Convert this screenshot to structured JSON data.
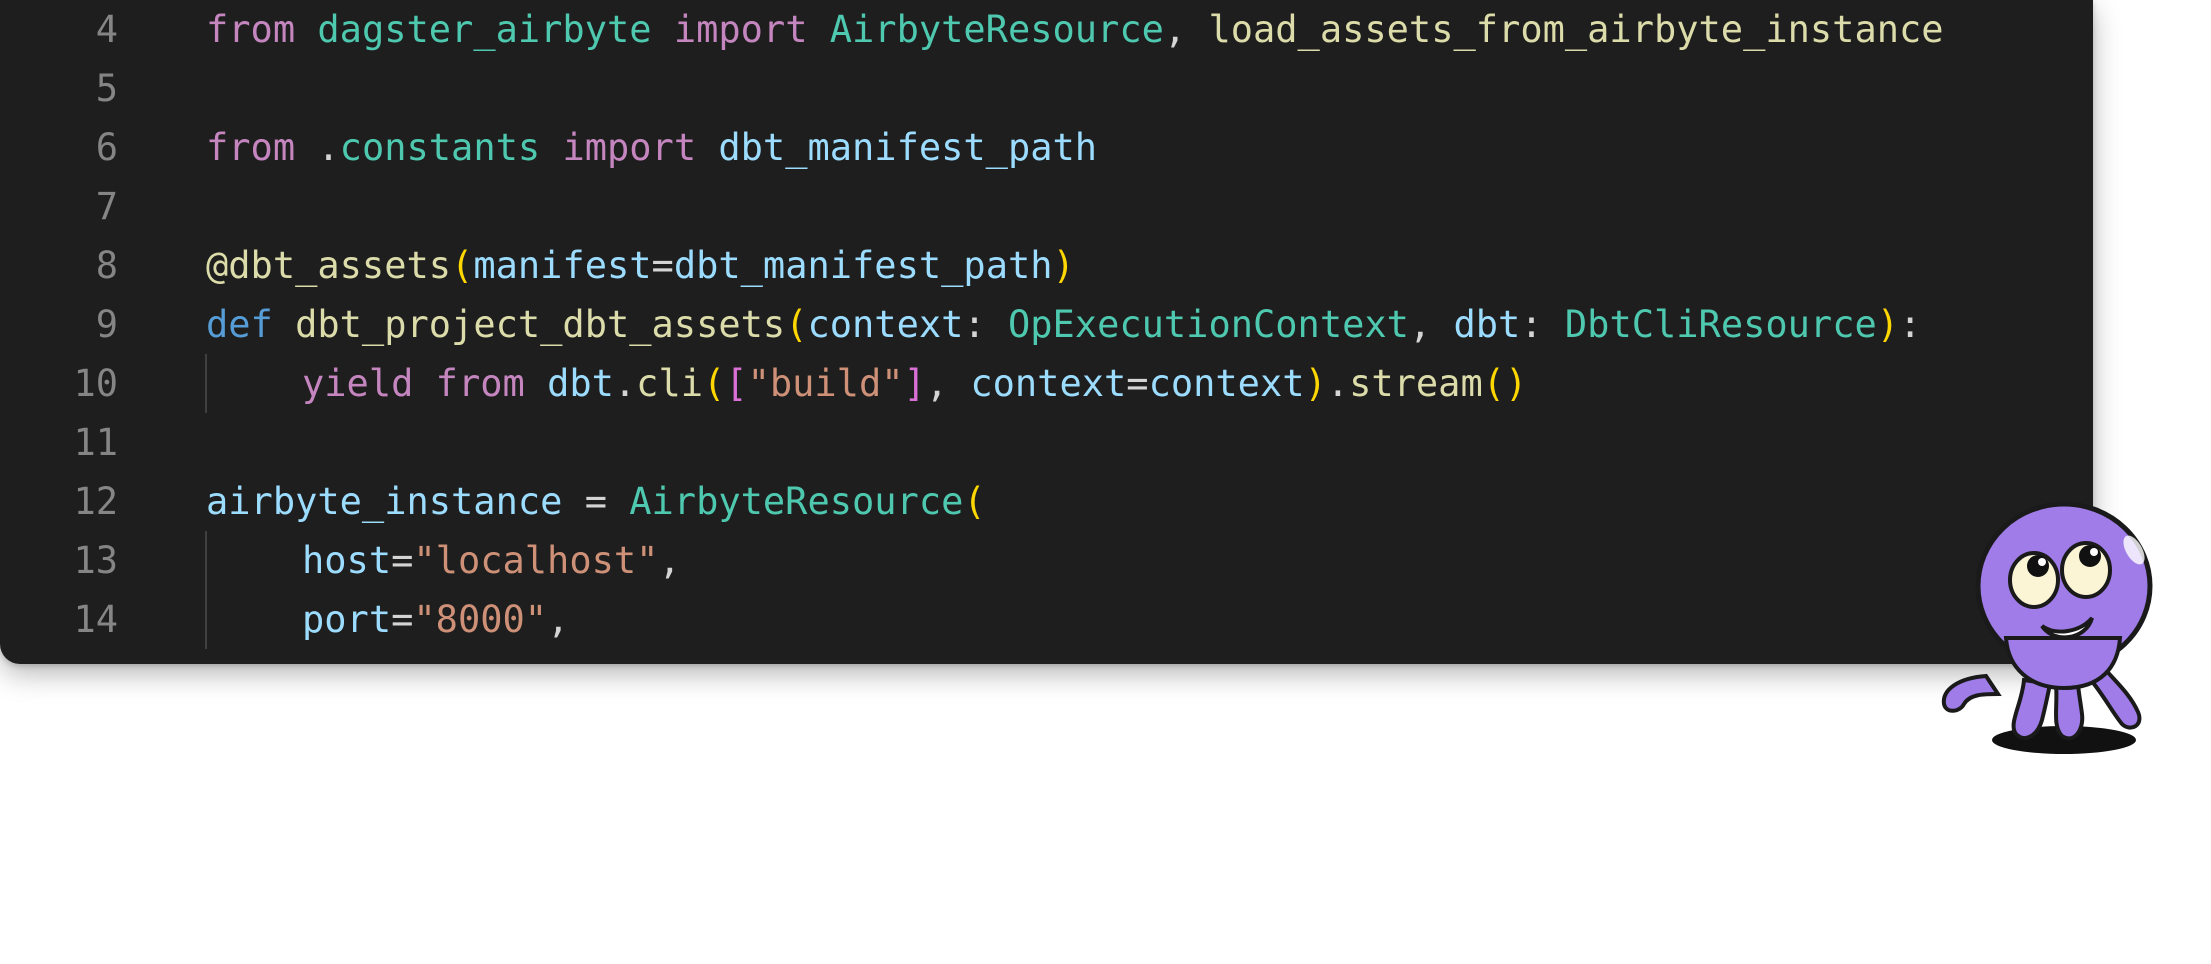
{
  "editor": {
    "background": "#1e1e1e",
    "lines": [
      {
        "number": "4",
        "tokens": [
          {
            "t": "from",
            "c": "kw"
          },
          {
            "t": " ",
            "c": "op"
          },
          {
            "t": "dagster_airbyte",
            "c": "mod"
          },
          {
            "t": " ",
            "c": "op"
          },
          {
            "t": "import",
            "c": "kw"
          },
          {
            "t": " ",
            "c": "op"
          },
          {
            "t": "AirbyteResource",
            "c": "cls"
          },
          {
            "t": ", ",
            "c": "op"
          },
          {
            "t": "load_assets_from_airbyte_instance",
            "c": "fn"
          }
        ]
      },
      {
        "number": "5",
        "tokens": []
      },
      {
        "number": "6",
        "tokens": [
          {
            "t": "from",
            "c": "kw"
          },
          {
            "t": " .",
            "c": "op"
          },
          {
            "t": "constants",
            "c": "mod"
          },
          {
            "t": " ",
            "c": "op"
          },
          {
            "t": "import",
            "c": "kw"
          },
          {
            "t": " ",
            "c": "op"
          },
          {
            "t": "dbt_manifest_path",
            "c": "var"
          }
        ]
      },
      {
        "number": "7",
        "tokens": []
      },
      {
        "number": "8",
        "tokens": [
          {
            "t": "@dbt_assets",
            "c": "fn"
          },
          {
            "t": "(",
            "c": "br1"
          },
          {
            "t": "manifest",
            "c": "var"
          },
          {
            "t": "=",
            "c": "op"
          },
          {
            "t": "dbt_manifest_path",
            "c": "var"
          },
          {
            "t": ")",
            "c": "br1"
          }
        ]
      },
      {
        "number": "9",
        "tokens": [
          {
            "t": "def",
            "c": "def"
          },
          {
            "t": " ",
            "c": "op"
          },
          {
            "t": "dbt_project_dbt_assets",
            "c": "fn"
          },
          {
            "t": "(",
            "c": "br1"
          },
          {
            "t": "context",
            "c": "var"
          },
          {
            "t": ": ",
            "c": "op"
          },
          {
            "t": "OpExecutionContext",
            "c": "cls"
          },
          {
            "t": ", ",
            "c": "op"
          },
          {
            "t": "dbt",
            "c": "var"
          },
          {
            "t": ": ",
            "c": "op"
          },
          {
            "t": "DbtCliResource",
            "c": "cls"
          },
          {
            "t": ")",
            "c": "br1"
          },
          {
            "t": ":",
            "c": "op"
          }
        ]
      },
      {
        "number": "10",
        "indent": true,
        "tokens": [
          {
            "t": "yield",
            "c": "kw"
          },
          {
            "t": " ",
            "c": "op"
          },
          {
            "t": "from",
            "c": "kw"
          },
          {
            "t": " ",
            "c": "op"
          },
          {
            "t": "dbt",
            "c": "var"
          },
          {
            "t": ".",
            "c": "op"
          },
          {
            "t": "cli",
            "c": "fn"
          },
          {
            "t": "(",
            "c": "br1"
          },
          {
            "t": "[",
            "c": "br2"
          },
          {
            "t": "\"build\"",
            "c": "str"
          },
          {
            "t": "]",
            "c": "br2"
          },
          {
            "t": ", ",
            "c": "op"
          },
          {
            "t": "context",
            "c": "var"
          },
          {
            "t": "=",
            "c": "op"
          },
          {
            "t": "context",
            "c": "var"
          },
          {
            "t": ")",
            "c": "br1"
          },
          {
            "t": ".",
            "c": "op"
          },
          {
            "t": "stream",
            "c": "fn"
          },
          {
            "t": "()",
            "c": "br1"
          }
        ]
      },
      {
        "number": "11",
        "tokens": []
      },
      {
        "number": "12",
        "tokens": [
          {
            "t": "airbyte_instance",
            "c": "var"
          },
          {
            "t": " = ",
            "c": "op"
          },
          {
            "t": "AirbyteResource",
            "c": "cls"
          },
          {
            "t": "(",
            "c": "br1"
          }
        ]
      },
      {
        "number": "13",
        "indent": true,
        "tokens": [
          {
            "t": "host",
            "c": "var"
          },
          {
            "t": "=",
            "c": "op"
          },
          {
            "t": "\"localhost\"",
            "c": "str"
          },
          {
            "t": ",",
            "c": "op"
          }
        ]
      },
      {
        "number": "14",
        "indent": true,
        "tokens": [
          {
            "t": "port",
            "c": "var"
          },
          {
            "t": "=",
            "c": "op"
          },
          {
            "t": "\"8000\"",
            "c": "str"
          },
          {
            "t": ",",
            "c": "op"
          }
        ]
      }
    ]
  },
  "mascot": {
    "icon": "octopus-mascot-icon",
    "body_color": "#9f7ce8",
    "outline_color": "#1a1a1a"
  }
}
